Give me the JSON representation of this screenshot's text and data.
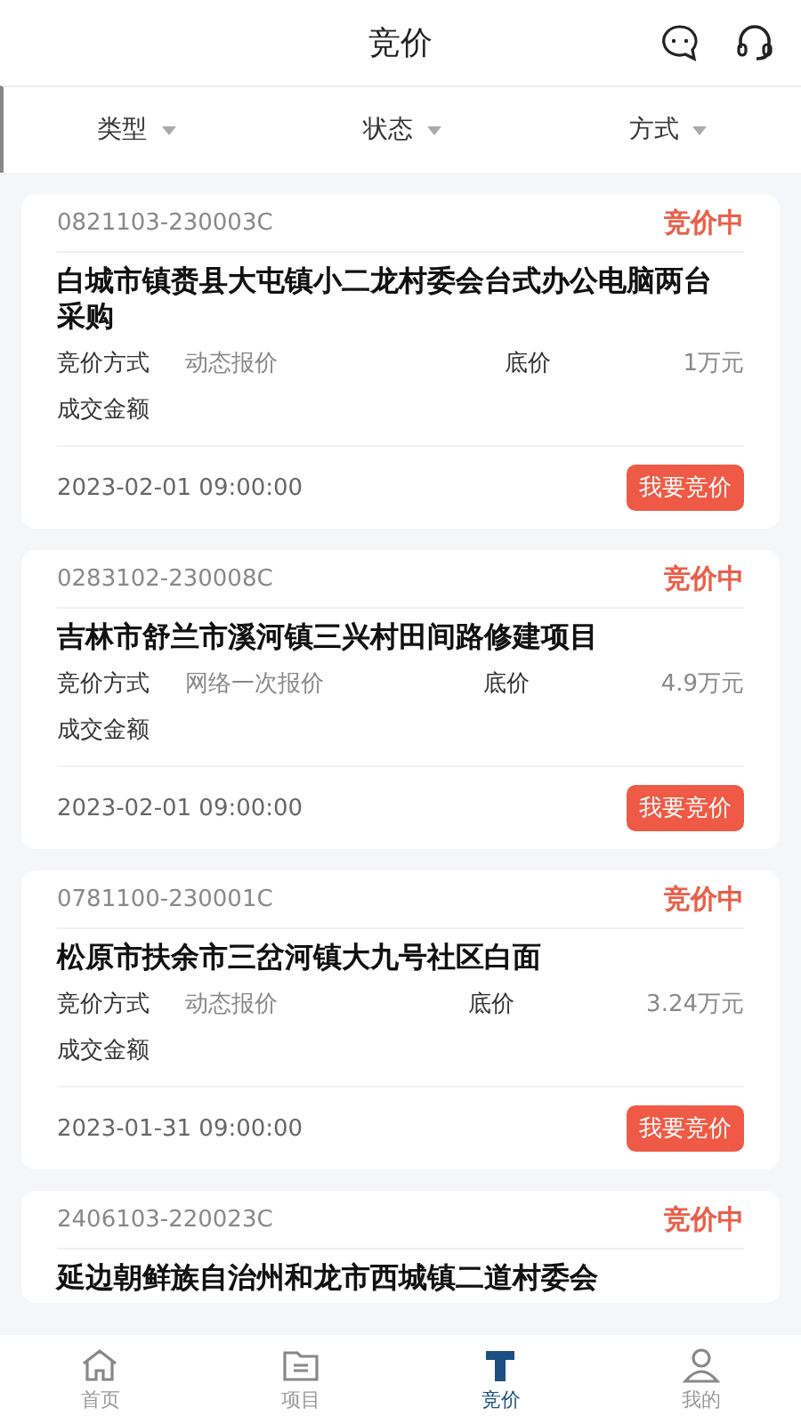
{
  "header": {
    "title": "竞价"
  },
  "filters": [
    {
      "label": "类型"
    },
    {
      "label": "状态"
    },
    {
      "label": "方式"
    }
  ],
  "cards": [
    {
      "code": "0821103-230003C",
      "status": "竞价中",
      "title": "白城市镇赉县大屯镇小二龙村委会台式办公电脑两台采购",
      "method_label": "竞价方式",
      "method": "动态报价",
      "price_label": "底价",
      "price": "1万元",
      "deal_label": "成交金额",
      "date": "2023-02-01 09:00:00",
      "button": "我要竞价"
    },
    {
      "code": "0283102-230008C",
      "status": "竞价中",
      "title": "吉林市舒兰市溪河镇三兴村田间路修建项目",
      "method_label": "竞价方式",
      "method": "网络一次报价",
      "price_label": "底价",
      "price": "4.9万元",
      "deal_label": "成交金额",
      "date": "2023-02-01 09:00:00",
      "button": "我要竞价"
    },
    {
      "code": "0781100-230001C",
      "status": "竞价中",
      "title": "松原市扶余市三岔河镇大九号社区白面",
      "method_label": "竞价方式",
      "method": "动态报价",
      "price_label": "底价",
      "price": "3.24万元",
      "deal_label": "成交金额",
      "date": "2023-01-31 09:00:00",
      "button": "我要竞价"
    },
    {
      "code": "2406103-220023C",
      "status": "竞价中",
      "title": "延边朝鲜族自治州和龙市西城镇二道村委会"
    }
  ],
  "tabbar": [
    {
      "kind": "home",
      "label": "首页",
      "selected": false
    },
    {
      "kind": "project",
      "label": "项目",
      "selected": false
    },
    {
      "kind": "bid",
      "label": "竞价",
      "selected": true
    },
    {
      "kind": "me",
      "label": "我的",
      "selected": false
    }
  ]
}
